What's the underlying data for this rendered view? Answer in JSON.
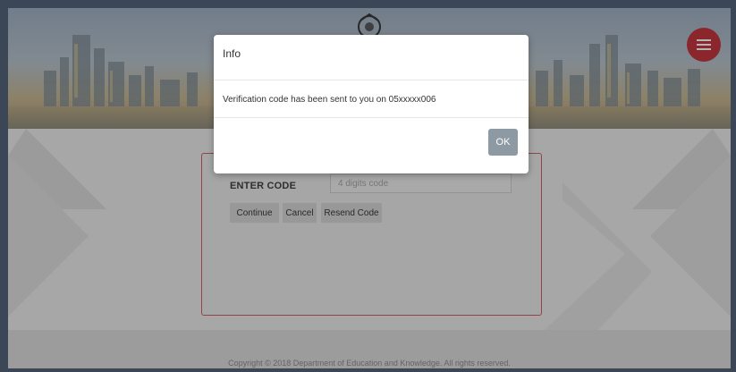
{
  "header": {
    "logo_icon": "crest-logo-icon",
    "menu_icon": "hamburger-menu-icon",
    "menu_color": "#c53238"
  },
  "form": {
    "code_label": "ENTER CODE",
    "code_placeholder": "4 digits code",
    "code_value": "",
    "continue_label": "Continue",
    "cancel_label": "Cancel",
    "resend_label": "Resend Code"
  },
  "footer": {
    "copyright": "Copyright © 2018 Department of Education and Knowledge. All rights reserved."
  },
  "modal": {
    "title": "Info",
    "message": "Verification code has been sent to you on 05xxxxx006",
    "ok_label": "OK"
  },
  "colors": {
    "accent_border": "#d15b5f",
    "ok_button": "#8d9aa4"
  }
}
